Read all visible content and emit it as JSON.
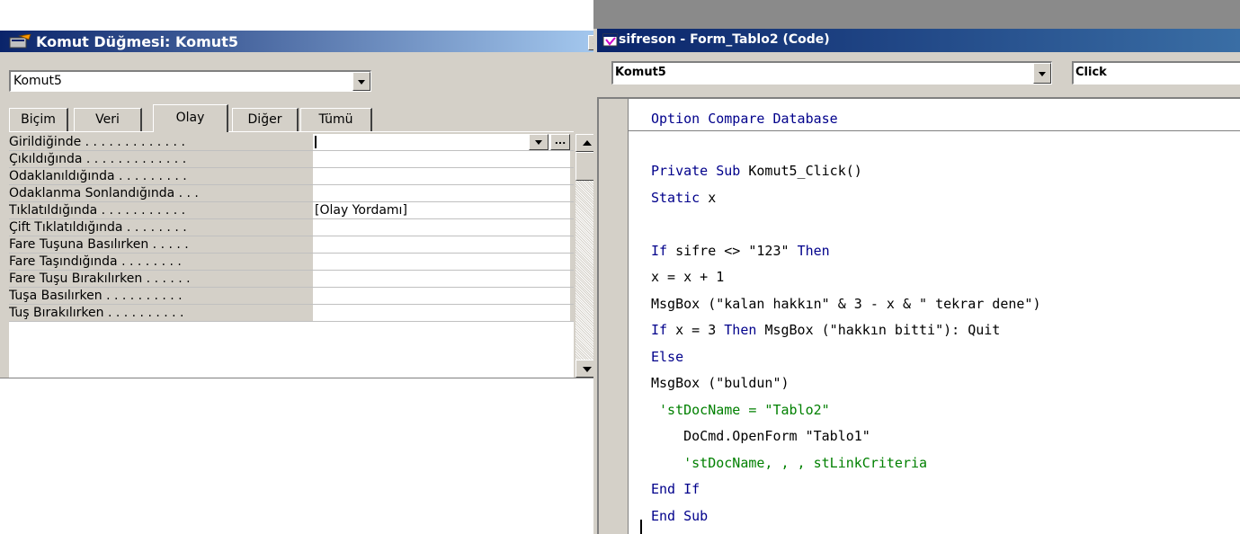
{
  "property_sheet": {
    "title": "Komut Düğmesi: Komut5",
    "selected_object": "Komut5",
    "tabs": [
      "Biçim",
      "Veri",
      "Olay",
      "Diğer",
      "Tümü"
    ],
    "active_tab": "Olay",
    "builder_button_label": "...",
    "properties": [
      {
        "label": "Girildiğinde . . . . . . . . . . . . .",
        "value": ""
      },
      {
        "label": "Çıkıldığında . . . . . . . . . . . . .",
        "value": ""
      },
      {
        "label": "Odaklanıldığında . . . . . . . . .",
        "value": ""
      },
      {
        "label": "Odaklanma Sonlandığında . . .",
        "value": ""
      },
      {
        "label": "Tıklatıldığında . . . . . . . . . . .",
        "value": "[Olay Yordamı]"
      },
      {
        "label": "Çift Tıklatıldığında . . . . . . . .",
        "value": ""
      },
      {
        "label": "Fare Tuşuna Basılırken . . . . .",
        "value": ""
      },
      {
        "label": "Fare Taşındığında . . . . . . . .",
        "value": ""
      },
      {
        "label": "Fare Tuşu Bırakılırken . . . . . .",
        "value": ""
      },
      {
        "label": "Tuşa Basılırken . . . . . . . . . .",
        "value": ""
      },
      {
        "label": "Tuş Bırakılırken . . . . . . . . . .",
        "value": ""
      }
    ]
  },
  "code_window": {
    "title": "sifreson - Form_Tablo2 (Code)",
    "object_combo": "Komut5",
    "procedure_combo": "Click",
    "declarations": "Option Compare Database",
    "lines": [
      [
        {
          "t": "Private Sub ",
          "c": "kw"
        },
        {
          "t": "Komut5_Click()",
          "c": ""
        }
      ],
      [
        {
          "t": "Static ",
          "c": "kw"
        },
        {
          "t": "x",
          "c": ""
        }
      ],
      [],
      [
        {
          "t": "If ",
          "c": "kw"
        },
        {
          "t": "sifre <> \"123\" ",
          "c": ""
        },
        {
          "t": "Then",
          "c": "kw"
        }
      ],
      [
        {
          "t": "x = x + 1",
          "c": ""
        }
      ],
      [
        {
          "t": "MsgBox (\"kalan hakkın\" & 3 - x & \" tekrar dene\")",
          "c": ""
        }
      ],
      [
        {
          "t": "If ",
          "c": "kw"
        },
        {
          "t": "x = 3 ",
          "c": ""
        },
        {
          "t": "Then ",
          "c": "kw"
        },
        {
          "t": "MsgBox (\"hakkın bitti\"): Quit",
          "c": ""
        }
      ],
      [
        {
          "t": "Else",
          "c": "kw"
        }
      ],
      [
        {
          "t": "MsgBox (\"buldun\")",
          "c": ""
        }
      ],
      [
        {
          "t": " 'stDocName = \"Tablo2\"",
          "c": "cm"
        }
      ],
      [
        {
          "t": "    DoCmd.OpenForm \"Tablo1\"",
          "c": ""
        }
      ],
      [
        {
          "t": "    'stDocName, , , stLinkCriteria",
          "c": "cm"
        }
      ],
      [
        {
          "t": "End If",
          "c": "kw"
        }
      ],
      [
        {
          "t": "End Sub",
          "c": "kw"
        }
      ]
    ]
  },
  "colors": {
    "keyword": "#00008b",
    "comment": "#008000",
    "title_bar": "#0a246a",
    "window_face": "#d4d0c8"
  }
}
